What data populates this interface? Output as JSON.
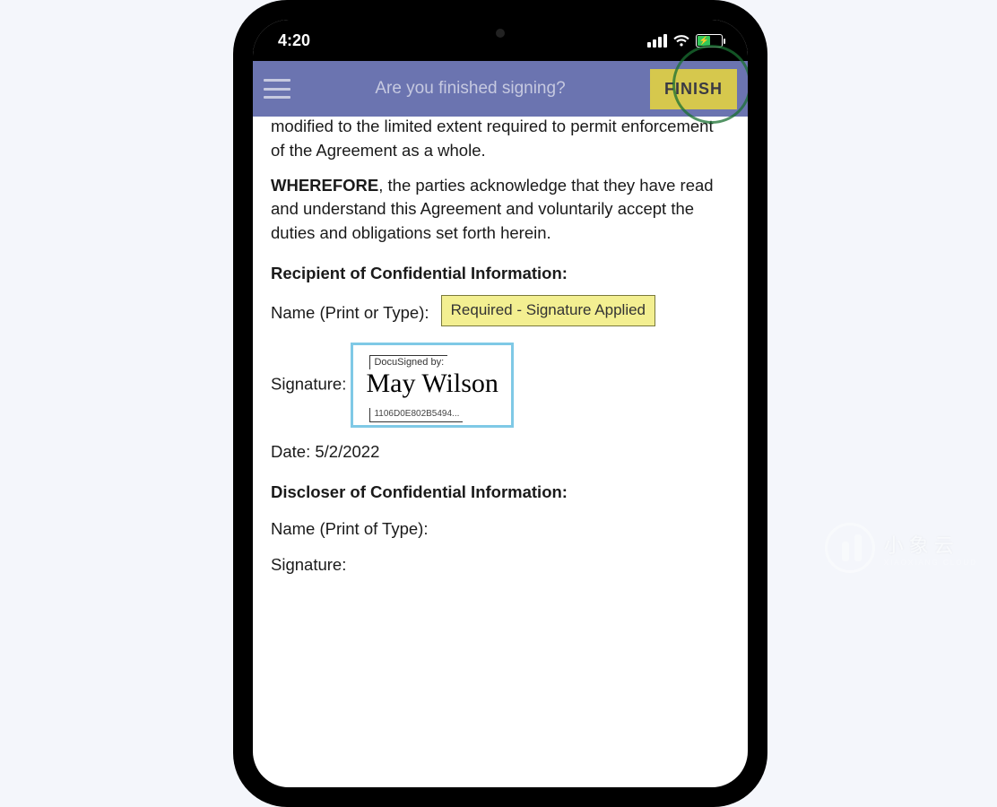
{
  "status": {
    "time": "4:20"
  },
  "header": {
    "title": "Are you finished signing?",
    "finish_label": "FINISH"
  },
  "doc": {
    "cut_tail": "modified to the limited extent required to permit enforcement of the Agreement as a whole.",
    "wherefore_strong": "WHEREFORE",
    "wherefore_rest": ", the parties acknowledge that they have read and understand this Agreement and voluntarily accept the duties and obligations set forth herein.",
    "recipient_heading": "Recipient of Confidential Information:",
    "name_label_prefix": "Name (Print or Type):",
    "tooltip": "Required - Signature Applied",
    "signature_label": "Signature:",
    "sig_header": "DocuSigned by:",
    "sig_script": "May Wilson",
    "sig_id": "1106D0E802B5494...",
    "date_label": "Date:",
    "date_value": "5/2/2022",
    "discloser_heading": "Discloser of Confidential Information:",
    "discloser_name_label": "Name (Print of Type):",
    "discloser_signature_label": "Signature:"
  },
  "watermark": {
    "brand": "小象云",
    "sub": "XIAOXIANG CLOUD"
  }
}
